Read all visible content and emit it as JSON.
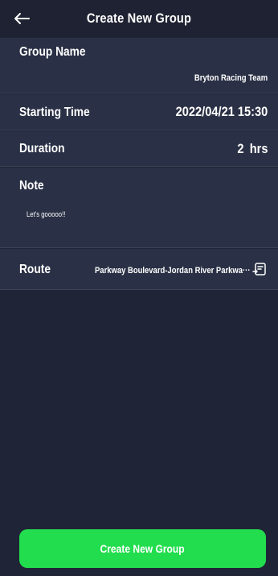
{
  "header": {
    "back_icon": "arrow-left-icon",
    "title": "Create New Group"
  },
  "form": {
    "group_name": {
      "label": "Group Name",
      "value": "Bryton Racing Team"
    },
    "starting_time": {
      "label": "Starting Time",
      "value": "2022/04/21 15:30"
    },
    "duration": {
      "label": "Duration",
      "value": "2",
      "unit": "hrs"
    },
    "note": {
      "label": "Note",
      "value": "Let's gooooo!!"
    },
    "route": {
      "label": "Route",
      "value": "Parkway Boulevard-Jordan River Parkwa···",
      "icon": "map-route-icon"
    }
  },
  "footer": {
    "create_label": "Create New Group"
  },
  "colors": {
    "background": "#1f2536",
    "section": "#2a3045",
    "accent": "#22dd4d"
  }
}
